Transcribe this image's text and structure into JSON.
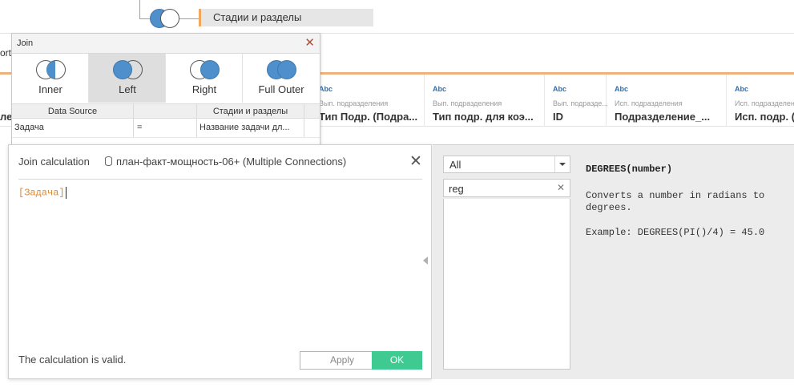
{
  "canvas": {
    "table_name": "Стадии и разделы"
  },
  "ort_fragment": "ort",
  "grid": {
    "left_ghost": "ле",
    "columns": [
      {
        "type": "Abc",
        "source": "Вып. подразделения",
        "name": "Тип Подр. (Подра..."
      },
      {
        "type": "Abc",
        "source": "Вып. подразделения",
        "name": "Тип подр. для коэ..."
      },
      {
        "type": "Abc",
        "source": "Вып. подразде...",
        "name": "ID"
      },
      {
        "type": "Abc",
        "source": "Исп. подразделения",
        "name": "Подразделение_..."
      },
      {
        "type": "Abc",
        "source": "Исп. подразделения",
        "name": "Исп. подр. (П"
      }
    ]
  },
  "join": {
    "title": "Join",
    "types": [
      {
        "label": "Inner",
        "selected": false
      },
      {
        "label": "Left",
        "selected": true
      },
      {
        "label": "Right",
        "selected": false
      },
      {
        "label": "Full Outer",
        "selected": false
      }
    ],
    "headers": {
      "data_source": "Data Source",
      "right_table": "Стадии и разделы"
    },
    "clauses": [
      {
        "left": "Задача",
        "operator": "=",
        "right": "Название задачи дл..."
      }
    ]
  },
  "calc": {
    "title": "Join calculation",
    "connection": "план-факт-мощность-06+ (Multiple Connections)",
    "formula": "[Задача]",
    "status": "The calculation is valid.",
    "apply_label": "Apply",
    "ok_label": "OK"
  },
  "functions": {
    "category": "All",
    "search": "reg",
    "signature": "DEGREES(number)",
    "description": "Converts a number in radians to degrees.",
    "example": "Example: DEGREES(PI()/4) = 45.0"
  },
  "colors": {
    "accent_orange": "#f0b27a",
    "venn_blue": "#4e8fcc",
    "ok_green": "#3fca92",
    "close_red": "#b64b2f",
    "formula_orange": "#e1882f"
  },
  "icons": {
    "join_node": "left-join-venn-icon",
    "close": "close-icon",
    "database": "database-icon",
    "dropdown": "chevron-down-icon",
    "clear": "clear-search-icon",
    "collapse": "collapse-arrow-icon"
  }
}
